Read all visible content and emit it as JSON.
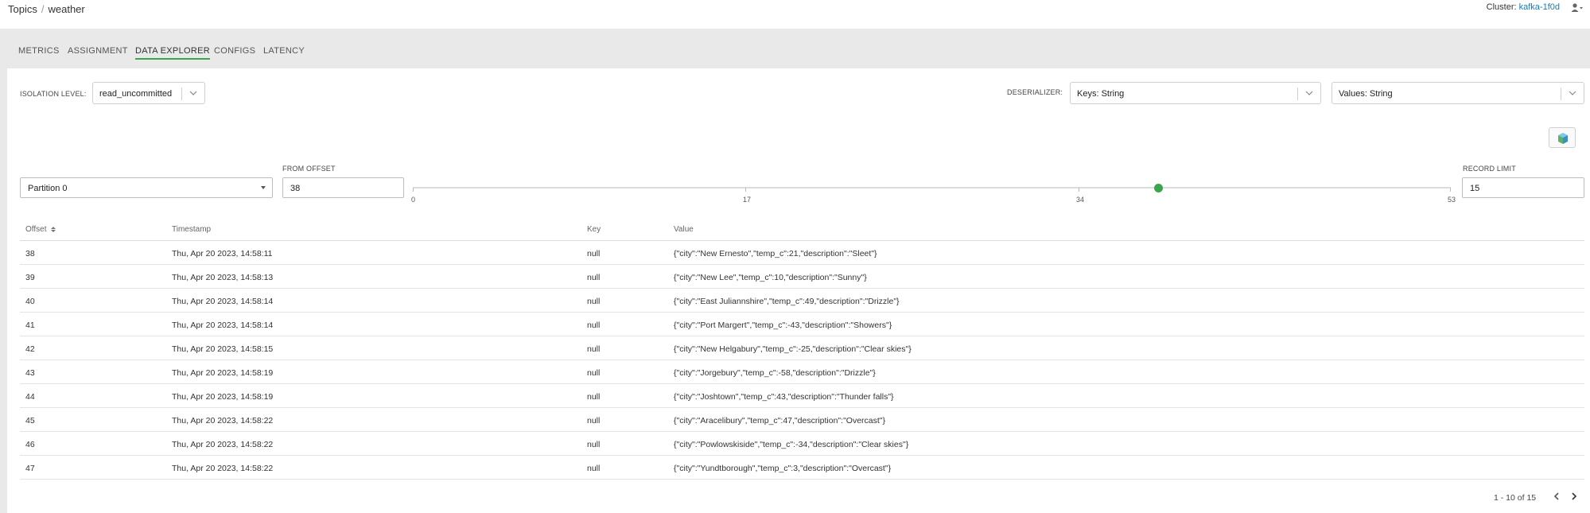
{
  "breadcrumb": {
    "root": "Topics",
    "separator": "/",
    "current": "weather"
  },
  "cluster": {
    "label": "Cluster:",
    "name": "kafka-1f0d"
  },
  "tabs": [
    "METRICS",
    "ASSIGNMENT",
    "DATA EXPLORER",
    "CONFIGS",
    "LATENCY"
  ],
  "active_tab": "DATA EXPLORER",
  "controls": {
    "isolation_label": "ISOLATION LEVEL:",
    "isolation_value": "read_uncommitted",
    "deserializer_label": "DESERIALIZER:",
    "keys_value": "Keys: String",
    "values_value": "Values: String",
    "partition_value": "Partition 0",
    "from_offset_label": "FROM OFFSET",
    "from_offset_value": "38",
    "record_limit_label": "RECORD LIMIT",
    "record_limit_value": "15"
  },
  "slider": {
    "ticks": [
      "0",
      "17",
      "34",
      "53"
    ],
    "value": 38,
    "min": 0,
    "max": 53
  },
  "table": {
    "headers": {
      "offset": "Offset",
      "timestamp": "Timestamp",
      "key": "Key",
      "value": "Value"
    },
    "rows": [
      {
        "offset": "38",
        "timestamp": "Thu, Apr 20 2023, 14:58:11",
        "key": "null",
        "value": "{\"city\":\"New Ernesto\",\"temp_c\":21,\"description\":\"Sleet\"}"
      },
      {
        "offset": "39",
        "timestamp": "Thu, Apr 20 2023, 14:58:13",
        "key": "null",
        "value": "{\"city\":\"New Lee\",\"temp_c\":10,\"description\":\"Sunny\"}"
      },
      {
        "offset": "40",
        "timestamp": "Thu, Apr 20 2023, 14:58:14",
        "key": "null",
        "value": "{\"city\":\"East Juliannshire\",\"temp_c\":49,\"description\":\"Drizzle\"}"
      },
      {
        "offset": "41",
        "timestamp": "Thu, Apr 20 2023, 14:58:14",
        "key": "null",
        "value": "{\"city\":\"Port Margert\",\"temp_c\":-43,\"description\":\"Showers\"}"
      },
      {
        "offset": "42",
        "timestamp": "Thu, Apr 20 2023, 14:58:15",
        "key": "null",
        "value": "{\"city\":\"New Helgabury\",\"temp_c\":-25,\"description\":\"Clear skies\"}"
      },
      {
        "offset": "43",
        "timestamp": "Thu, Apr 20 2023, 14:58:19",
        "key": "null",
        "value": "{\"city\":\"Jorgebury\",\"temp_c\":-58,\"description\":\"Drizzle\"}"
      },
      {
        "offset": "44",
        "timestamp": "Thu, Apr 20 2023, 14:58:19",
        "key": "null",
        "value": "{\"city\":\"Joshtown\",\"temp_c\":43,\"description\":\"Thunder falls\"}"
      },
      {
        "offset": "45",
        "timestamp": "Thu, Apr 20 2023, 14:58:22",
        "key": "null",
        "value": "{\"city\":\"Aracelibury\",\"temp_c\":47,\"description\":\"Overcast\"}"
      },
      {
        "offset": "46",
        "timestamp": "Thu, Apr 20 2023, 14:58:22",
        "key": "null",
        "value": "{\"city\":\"Powlowskiside\",\"temp_c\":-34,\"description\":\"Clear skies\"}"
      },
      {
        "offset": "47",
        "timestamp": "Thu, Apr 20 2023, 14:58:22",
        "key": "null",
        "value": "{\"city\":\"Yundtborough\",\"temp_c\":3,\"description\":\"Overcast\"}"
      }
    ]
  },
  "pagination": {
    "text": "1 - 10 of 15"
  },
  "colors": {
    "accent": "#3aa54a",
    "link": "#1a7bb8",
    "band": "#e9e9e9"
  },
  "icons": {
    "user": "user-icon",
    "cube": "cube-icon",
    "sort": "sort-icon",
    "prev": "chevron-left-icon",
    "next": "chevron-right-icon"
  }
}
